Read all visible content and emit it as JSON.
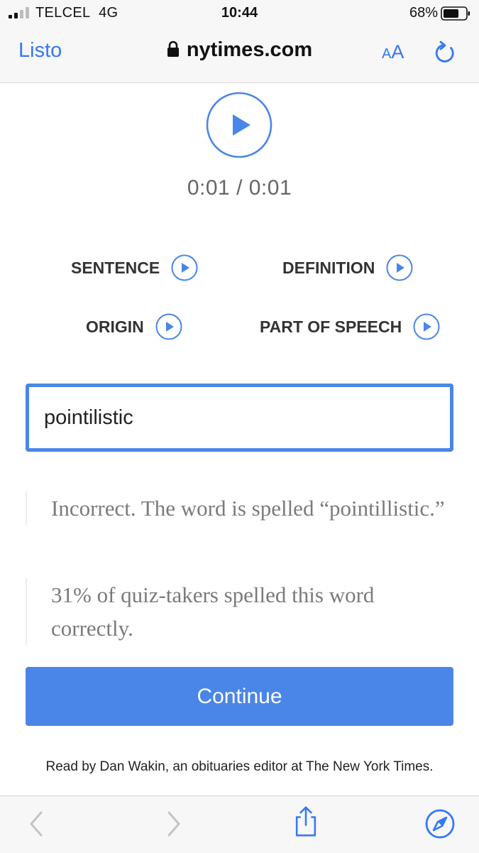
{
  "status_bar": {
    "carrier": "TELCEL",
    "network": "4G",
    "time": "10:44",
    "battery": "68%"
  },
  "browser": {
    "done_label": "Listo",
    "url": "nytimes.com",
    "text_size_small": "A",
    "text_size_large": "A"
  },
  "player": {
    "time": "0:01 / 0:01"
  },
  "options": [
    {
      "label": "SENTENCE"
    },
    {
      "label": "DEFINITION"
    },
    {
      "label": "ORIGIN"
    },
    {
      "label": "PART OF SPEECH"
    }
  ],
  "answer": {
    "value": "pointilistic"
  },
  "feedback": {
    "result": "Incorrect. The word is spelled “pointillistic.”",
    "stat": "31% of quiz-takers spelled this word correctly."
  },
  "continue_label": "Continue",
  "credit": "Read by Dan Wakin, an obituaries editor at The New York Times.",
  "colors": {
    "accent": "#4a86e8",
    "ios_blue": "#3478f6"
  }
}
